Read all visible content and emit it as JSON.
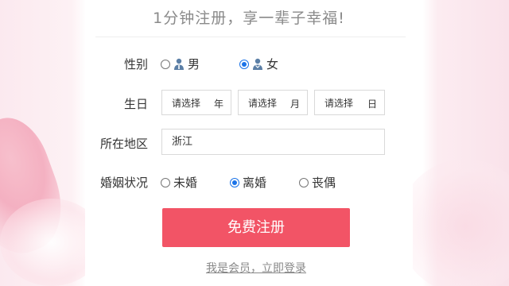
{
  "header": {
    "title": "1分钟注册，享一辈子幸福!"
  },
  "form": {
    "gender": {
      "label": "性别",
      "options": [
        {
          "label": "男",
          "icon": "male-user-icon",
          "checked": false
        },
        {
          "label": "女",
          "icon": "female-user-icon",
          "checked": true
        }
      ]
    },
    "birthday": {
      "label": "生日",
      "year": {
        "placeholder": "请选择",
        "unit": "年"
      },
      "month": {
        "placeholder": "请选择",
        "unit": "月"
      },
      "day": {
        "placeholder": "请选择",
        "unit": "日"
      }
    },
    "region": {
      "label": "所在地区",
      "value": "浙江"
    },
    "marital": {
      "label": "婚姻状况",
      "options": [
        {
          "label": "未婚",
          "checked": false
        },
        {
          "label": "离婚",
          "checked": true
        },
        {
          "label": "丧偶",
          "checked": false
        }
      ]
    },
    "submit_label": "免费注册",
    "login_link": "我是会员，立即登录"
  },
  "colors": {
    "accent": "#f25466",
    "radio_checked": "#1a73e8",
    "icon_blue": "#5b7fa6"
  }
}
